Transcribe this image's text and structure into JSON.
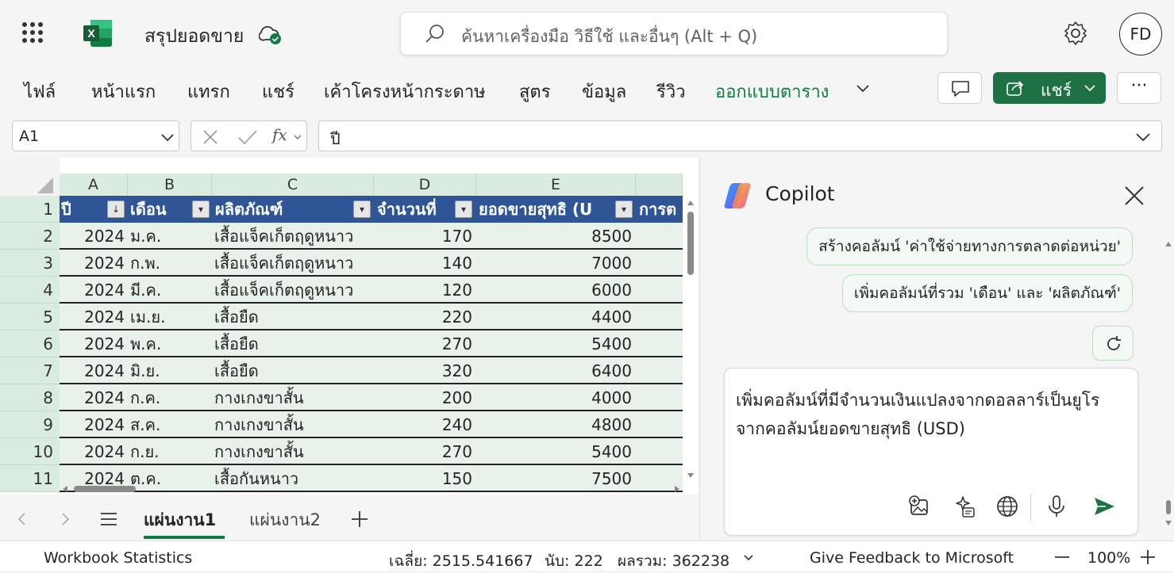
{
  "app": {
    "title": "สรุปยอดขาย",
    "avatar_initials": "FD"
  },
  "search": {
    "placeholder": "ค้นหาเครื่องมือ วิธีใช้ และอื่นๆ (Alt + Q)"
  },
  "ribbon": {
    "tabs": [
      "ไฟล์",
      "หน้าแรก",
      "แทรก",
      "แชร์",
      "เค้าโครงหน้ากระดาษ",
      "สูตร",
      "ข้อมูล",
      "รีวิว",
      "ออกแบบตาราง"
    ],
    "active_tab": "ออกแบบตาราง",
    "share_label": "แชร์",
    "overflow_label": "···"
  },
  "formula_bar": {
    "name_box": "A1",
    "fx_label": "fx",
    "formula": "ปี"
  },
  "sheet": {
    "columns": [
      "A",
      "B",
      "C",
      "D",
      "E"
    ],
    "headers": [
      "ปี",
      "เดือน",
      "ผลิตภัณฑ์",
      "จำนวนที่",
      "ยอดขายสุทธิ (U",
      "การต"
    ],
    "rows": [
      {
        "n": "2",
        "year": "2024",
        "month": "ม.ค.",
        "product": "เสื้อแจ็คเก็ตฤดูหนาว",
        "qty": "170",
        "net": "8500"
      },
      {
        "n": "3",
        "year": "2024",
        "month": "ก.พ.",
        "product": "เสื้อแจ็คเก็ตฤดูหนาว",
        "qty": "140",
        "net": "7000"
      },
      {
        "n": "4",
        "year": "2024",
        "month": "มี.ค.",
        "product": "เสื้อแจ็คเก็ตฤดูหนาว",
        "qty": "120",
        "net": "6000"
      },
      {
        "n": "5",
        "year": "2024",
        "month": "เม.ย.",
        "product": "เสื้อยืด",
        "qty": "220",
        "net": "4400"
      },
      {
        "n": "6",
        "year": "2024",
        "month": "พ.ค.",
        "product": "เสื้อยืด",
        "qty": "270",
        "net": "5400"
      },
      {
        "n": "7",
        "year": "2024",
        "month": "มิ.ย.",
        "product": "เสื้อยืด",
        "qty": "320",
        "net": "6400"
      },
      {
        "n": "8",
        "year": "2024",
        "month": "ก.ค.",
        "product": "กางเกงขาสั้น",
        "qty": "200",
        "net": "4000"
      },
      {
        "n": "9",
        "year": "2024",
        "month": "ส.ค.",
        "product": "กางเกงขาสั้น",
        "qty": "240",
        "net": "4800"
      },
      {
        "n": "10",
        "year": "2024",
        "month": "ก.ย.",
        "product": "กางเกงขาสั้น",
        "qty": "270",
        "net": "5400"
      },
      {
        "n": "11",
        "year": "2024",
        "month": "ต.ค.",
        "product": "เสื้อกันหนาว",
        "qty": "150",
        "net": "7500"
      }
    ],
    "tabs": [
      "แผ่นงาน1",
      "แผ่นงาน2"
    ],
    "active_tab": "แผ่นงาน1"
  },
  "copilot": {
    "title": "Copilot",
    "suggestions": [
      "สร้างคอลัมน์ 'ค่าใช้จ่ายทางการตลาดต่อหน่วย'",
      "เพิ่มคอลัมน์ที่รวม 'เดือน' และ 'ผลิตภัณฑ์'"
    ],
    "prompt": "เพิ่มคอลัมน์ที่มีจำนวนเงินแปลงจากดอลลาร์เป็นยูโรจากคอลัมน์ยอดขายสุทธิ (USD)"
  },
  "status": {
    "workbook_stats": "Workbook Statistics",
    "average": "เฉลี่ย: 2515.541667",
    "count": "นับ: 222",
    "sum": "ผลรวม: 362238",
    "feedback": "Give Feedback to Microsoft",
    "zoom": "100%"
  },
  "colors": {
    "accent": "#107c41",
    "table_header": "#2f5597",
    "share_button": "#1e7145"
  }
}
